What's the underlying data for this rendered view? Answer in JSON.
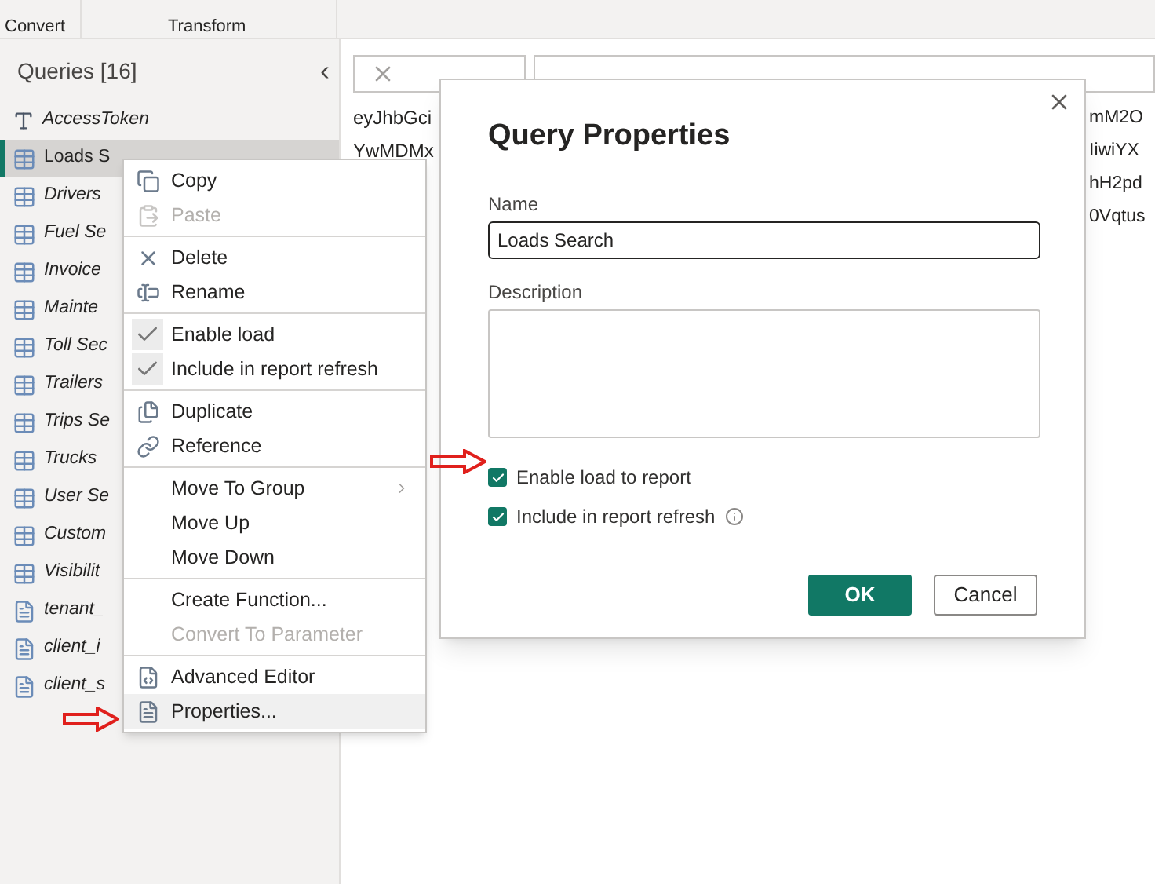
{
  "ribbon": {
    "groups": [
      "Convert",
      "Transform"
    ]
  },
  "queries_panel": {
    "title": "Queries [16]",
    "collapse": "‹",
    "items": [
      {
        "name": "AccessToken",
        "kind": "text",
        "selected": false,
        "load_enabled": false
      },
      {
        "name": "Loads S",
        "kind": "table",
        "selected": true,
        "load_enabled": true
      },
      {
        "name": "Drivers",
        "kind": "table",
        "selected": false,
        "load_enabled": false
      },
      {
        "name": "Fuel Se",
        "kind": "table",
        "selected": false,
        "load_enabled": false
      },
      {
        "name": "Invoice",
        "kind": "table",
        "selected": false,
        "load_enabled": false
      },
      {
        "name": "Mainte",
        "kind": "table",
        "selected": false,
        "load_enabled": false
      },
      {
        "name": "Toll Sec",
        "kind": "table",
        "selected": false,
        "load_enabled": false
      },
      {
        "name": "Trailers",
        "kind": "table",
        "selected": false,
        "load_enabled": false
      },
      {
        "name": "Trips Se",
        "kind": "table",
        "selected": false,
        "load_enabled": false
      },
      {
        "name": "Trucks",
        "kind": "table",
        "selected": false,
        "load_enabled": false
      },
      {
        "name": "User Se",
        "kind": "table",
        "selected": false,
        "load_enabled": false
      },
      {
        "name": "Custom",
        "kind": "table",
        "selected": false,
        "load_enabled": false
      },
      {
        "name": "Visibilit",
        "kind": "table",
        "selected": false,
        "load_enabled": false
      },
      {
        "name": "tenant_",
        "kind": "parameter",
        "selected": false,
        "load_enabled": false
      },
      {
        "name": "client_i",
        "kind": "parameter",
        "selected": false,
        "load_enabled": false
      },
      {
        "name": "client_s",
        "kind": "parameter",
        "selected": false,
        "load_enabled": false
      }
    ]
  },
  "data_preview": {
    "left_cells": [
      "eyJhbGci",
      "YwMDMx"
    ],
    "right_cells": [
      "mM2O",
      "IiwiYX",
      "hH2pd",
      "0Vqtus"
    ]
  },
  "context_menu": {
    "groups": [
      [
        {
          "label": "Copy",
          "disabled": false
        },
        {
          "label": "Paste",
          "disabled": true
        }
      ],
      [
        {
          "label": "Delete",
          "disabled": false
        },
        {
          "label": "Rename",
          "disabled": false
        }
      ],
      [
        {
          "label": "Enable load",
          "disabled": false,
          "checked": true
        },
        {
          "label": "Include in report refresh",
          "disabled": false,
          "checked": true
        }
      ],
      [
        {
          "label": "Duplicate",
          "disabled": false
        },
        {
          "label": "Reference",
          "disabled": false
        }
      ],
      [
        {
          "label": "Move To Group",
          "disabled": false,
          "submenu": true
        },
        {
          "label": "Move Up",
          "disabled": false
        },
        {
          "label": "Move Down",
          "disabled": false
        }
      ],
      [
        {
          "label": "Create Function...",
          "disabled": false
        },
        {
          "label": "Convert To Parameter",
          "disabled": true
        }
      ],
      [
        {
          "label": "Advanced Editor",
          "disabled": false
        },
        {
          "label": "Properties...",
          "disabled": false,
          "selected": true
        }
      ]
    ]
  },
  "dialog": {
    "title": "Query Properties",
    "name_label": "Name",
    "name_value": "Loads Search",
    "description_label": "Description",
    "checkboxes": [
      {
        "label": "Enable load to report",
        "checked": true
      },
      {
        "label": "Include in report refresh",
        "checked": true,
        "info": true
      }
    ],
    "buttons": [
      "OK",
      "Cancel"
    ]
  }
}
